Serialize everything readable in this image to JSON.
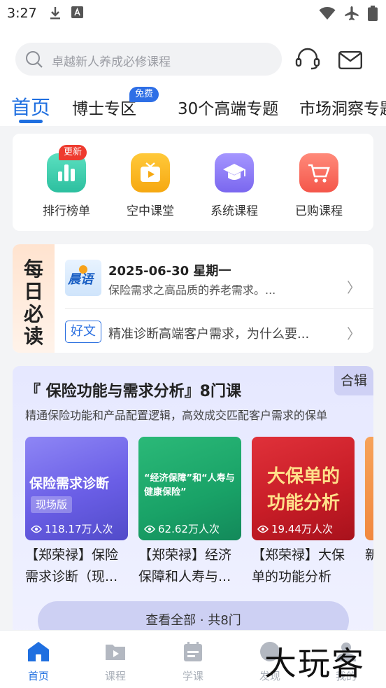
{
  "status_bar": {
    "time": "3:27"
  },
  "search": {
    "placeholder": "卓越新人养成必修课程"
  },
  "tabs": [
    {
      "label": "首页"
    },
    {
      "label": "博士专区",
      "badge": "免费"
    },
    {
      "label": "30个高端专题"
    },
    {
      "label": "市场洞察专题"
    }
  ],
  "quick_entries": [
    {
      "label": "排行榜单",
      "badge": "更新",
      "color": "#38c8a8"
    },
    {
      "label": "空中课堂",
      "color": "#f7b21f"
    },
    {
      "label": "系统课程",
      "color": "#8b7cf3"
    },
    {
      "label": "已购课程",
      "color": "#fb6a5e"
    }
  ],
  "daily_read": {
    "side_label": "每日必读",
    "logo_text": "晨语",
    "date": "2025-06-30 星期一",
    "summary": "保险需求之高品质的养老需求。...",
    "tag": "好文",
    "article": "精准诊断高端客户需求，为什么要..."
  },
  "series": {
    "tag": "合辑",
    "title": "『 保险功能与需求分析』8门课",
    "subtitle": "精通保险功能和产品配置逻辑，高效成交匹配客户需求的保单",
    "courses": [
      {
        "thumb_title": "保险需求诊断",
        "thumb_badge": "现场版",
        "views": "118.17万人次",
        "title": "【郑荣禄】保险需求诊断（现..."
      },
      {
        "thumb_title": "“经济保障”和“人寿与健康保险”",
        "views": "62.62万人次",
        "title": "【郑荣禄】经济保障和人寿与..."
      },
      {
        "thumb_title": "大保单的功能分析",
        "views": "19.44万人次",
        "title": "【郑荣禄】大保单的功能分析"
      },
      {
        "thumb_title": "",
        "views": "",
        "title": "新"
      }
    ],
    "view_all": "查看全部 · 共8门"
  },
  "bottom_nav": [
    {
      "label": "首页",
      "active": true
    },
    {
      "label": "课程"
    },
    {
      "label": "学课"
    },
    {
      "label": "发现"
    },
    {
      "label": "我的"
    }
  ],
  "watermark": "大玩客"
}
